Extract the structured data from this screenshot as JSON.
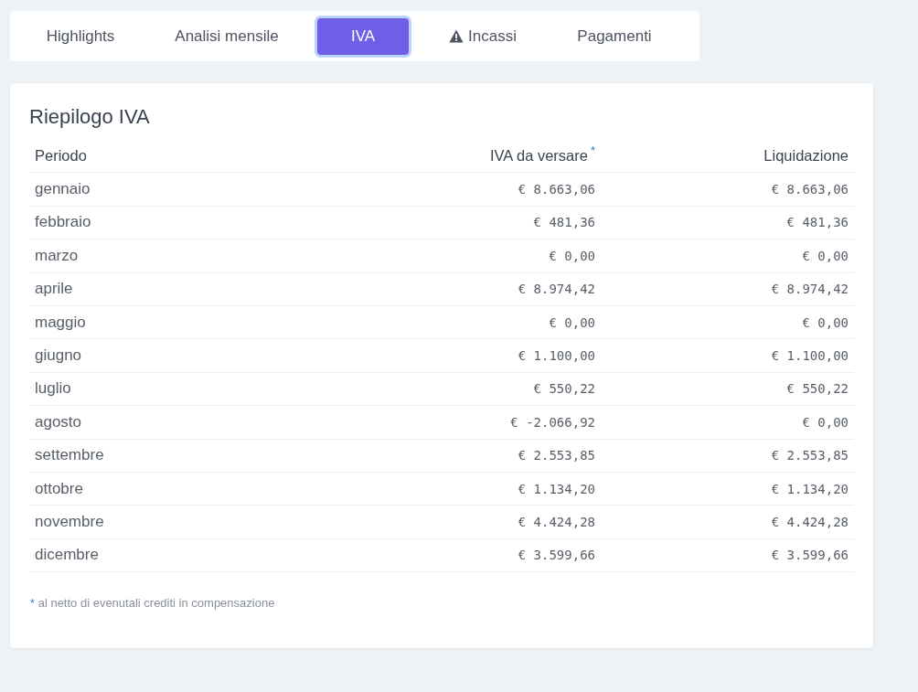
{
  "tabs": [
    {
      "label": "Highlights",
      "selected": false,
      "warning": false
    },
    {
      "label": "Analisi mensile",
      "selected": false,
      "warning": false
    },
    {
      "label": "IVA",
      "selected": true,
      "warning": false
    },
    {
      "label": "Incassi",
      "selected": false,
      "warning": true
    },
    {
      "label": "Pagamenti",
      "selected": false,
      "warning": false
    }
  ],
  "card": {
    "title": "Riepilogo IVA",
    "columns": [
      {
        "label": "Periodo"
      },
      {
        "label": "IVA da versare",
        "mark": "*"
      },
      {
        "label": "Liquidazione"
      }
    ],
    "rows": [
      [
        "gennaio",
        "€ 8.663,06",
        "€ 8.663,06"
      ],
      [
        "febbraio",
        "€ 481,36",
        "€ 481,36"
      ],
      [
        "marzo",
        "€ 0,00",
        "€ 0,00"
      ],
      [
        "aprile",
        "€ 8.974,42",
        "€ 8.974,42"
      ],
      [
        "maggio",
        "€ 0,00",
        "€ 0,00"
      ],
      [
        "giugno",
        "€ 1.100,00",
        "€ 1.100,00"
      ],
      [
        "luglio",
        "€ 550,22",
        "€ 550,22"
      ],
      [
        "agosto",
        "€ -2.066,92",
        "€ 0,00"
      ],
      [
        "settembre",
        "€ 2.553,85",
        "€ 2.553,85"
      ],
      [
        "ottobre",
        "€ 1.134,20",
        "€ 1.134,20"
      ],
      [
        "novembre",
        "€ 4.424,28",
        "€ 4.424,28"
      ],
      [
        "dicembre",
        "€ 3.599,66",
        "€ 3.599,66"
      ]
    ],
    "footnote": {
      "mark": "*",
      "text": "al netto di evenutali crediti in compensazione"
    }
  }
}
